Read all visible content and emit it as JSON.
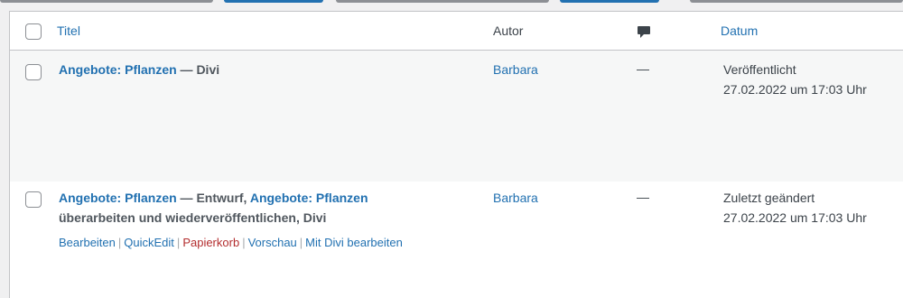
{
  "columns": {
    "title": "Titel",
    "author": "Autor",
    "date": "Datum"
  },
  "rows": [
    {
      "title": "Angebote: Pflanzen",
      "suffix": " — Divi",
      "author": "Barbara",
      "comments": "—",
      "status": "Veröffentlicht",
      "date": "27.02.2022 um 17:03 Uhr"
    },
    {
      "title": "Angebote: Pflanzen",
      "state": " — Entwurf, ",
      "title2": "Angebote: Pflanzen",
      "suffix_line1": "",
      "suffix_line2": "überarbeiten und wiederveröffentlichen, Divi",
      "author": "Barbara",
      "comments": "—",
      "status": "Zuletzt geändert",
      "date": "27.02.2022 um 17:03 Uhr",
      "actions": {
        "edit": "Bearbeiten",
        "quickedit": "QuickEdit",
        "trash": "Papierkorb",
        "preview": "Vorschau",
        "divi": "Mit Divi bearbeiten",
        "sep": "|"
      }
    }
  ]
}
